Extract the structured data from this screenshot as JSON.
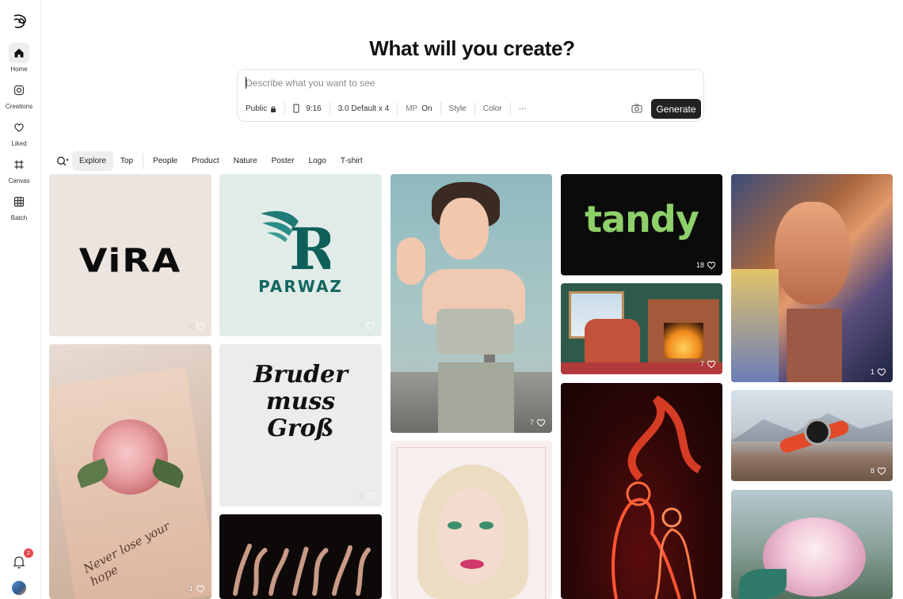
{
  "sidebar": {
    "items": [
      {
        "label": "Home",
        "icon": "home-icon"
      },
      {
        "label": "Creations",
        "icon": "creations-icon"
      },
      {
        "label": "Liked",
        "icon": "heart-icon"
      },
      {
        "label": "Canvas",
        "icon": "canvas-icon"
      },
      {
        "label": "Batch",
        "icon": "batch-icon"
      }
    ],
    "notifications_count": "2"
  },
  "header": {
    "title": "What will you create?"
  },
  "prompt": {
    "placeholder": "Describe what you want to see",
    "options": {
      "visibility": "Public",
      "aspect": "9:16",
      "model": "3.0 Default x 4",
      "mp_label": "MP",
      "mp_value": "On",
      "style": "Style",
      "color": "Color",
      "more": "···"
    },
    "generate_label": "Generate"
  },
  "filters": {
    "tabs": [
      "Explore",
      "Top"
    ],
    "categories": [
      "People",
      "Product",
      "Nature",
      "Poster",
      "Logo",
      "T-shirt"
    ],
    "active": "Explore"
  },
  "cards": [
    {
      "name": "vira-logo",
      "text": "ViRA",
      "likes": "6"
    },
    {
      "name": "parwaz-logo",
      "text": "R",
      "subtext": "PARWAZ",
      "likes": "4"
    },
    {
      "name": "retro-woman",
      "likes": "7"
    },
    {
      "name": "tandy-logo",
      "text": "tandy",
      "likes": "18"
    },
    {
      "name": "painted-face",
      "likes": "1"
    },
    {
      "name": "cozy-fireplace-room",
      "likes": "7"
    },
    {
      "name": "smartwatch-on-rock",
      "likes": "8"
    },
    {
      "name": "rose-envelope",
      "text": "Never lose your hope",
      "likes": "1"
    },
    {
      "name": "bruder-muss-gross-shirt",
      "text": "Bruder muss Groß",
      "likes": "0"
    },
    {
      "name": "flame-couple",
      "likes": ""
    },
    {
      "name": "glam-woman-portrait",
      "likes": ""
    },
    {
      "name": "rope-lettering",
      "likes": ""
    },
    {
      "name": "peony-flower",
      "likes": ""
    }
  ],
  "colors": {
    "generate_bg": "#222222",
    "badge": "#e5484d",
    "active_bg": "#eeeeee"
  }
}
